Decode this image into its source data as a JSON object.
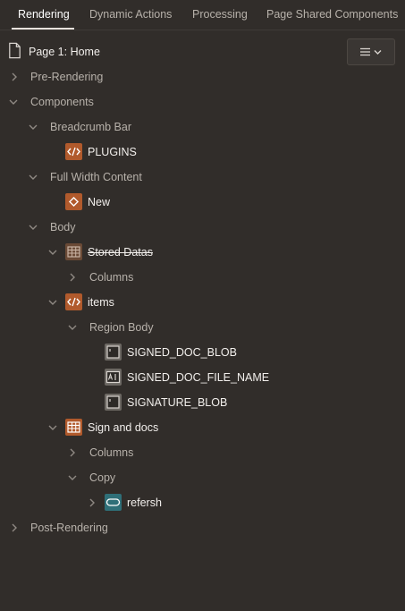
{
  "tabs": [
    {
      "label": "Rendering",
      "active": true
    },
    {
      "label": "Dynamic Actions"
    },
    {
      "label": "Processing"
    },
    {
      "label": "Page Shared Components"
    }
  ],
  "tree": {
    "page": "Page 1: Home",
    "pre_rendering": "Pre-Rendering",
    "components": "Components",
    "breadcrumb_bar": "Breadcrumb Bar",
    "plugins": "PLUGINS",
    "full_width_content": "Full Width Content",
    "new": "New",
    "body": "Body",
    "stored_datas": "Stored Datas",
    "columns_1": "Columns",
    "items": "items",
    "region_body": "Region Body",
    "signed_doc_blob": "SIGNED_DOC_BLOB",
    "signed_doc_file_name": "SIGNED_DOC_FILE_NAME",
    "signature_blob": "SIGNATURE_BLOB",
    "sign_and_docs": "Sign and docs",
    "columns_2": "Columns",
    "copy": "Copy",
    "refersh": "refersh",
    "post_rendering": "Post-Rendering"
  },
  "colors": {
    "background": "#312d2a",
    "accent_orange": "#b15a2c",
    "accent_teal": "#2f6f78"
  }
}
